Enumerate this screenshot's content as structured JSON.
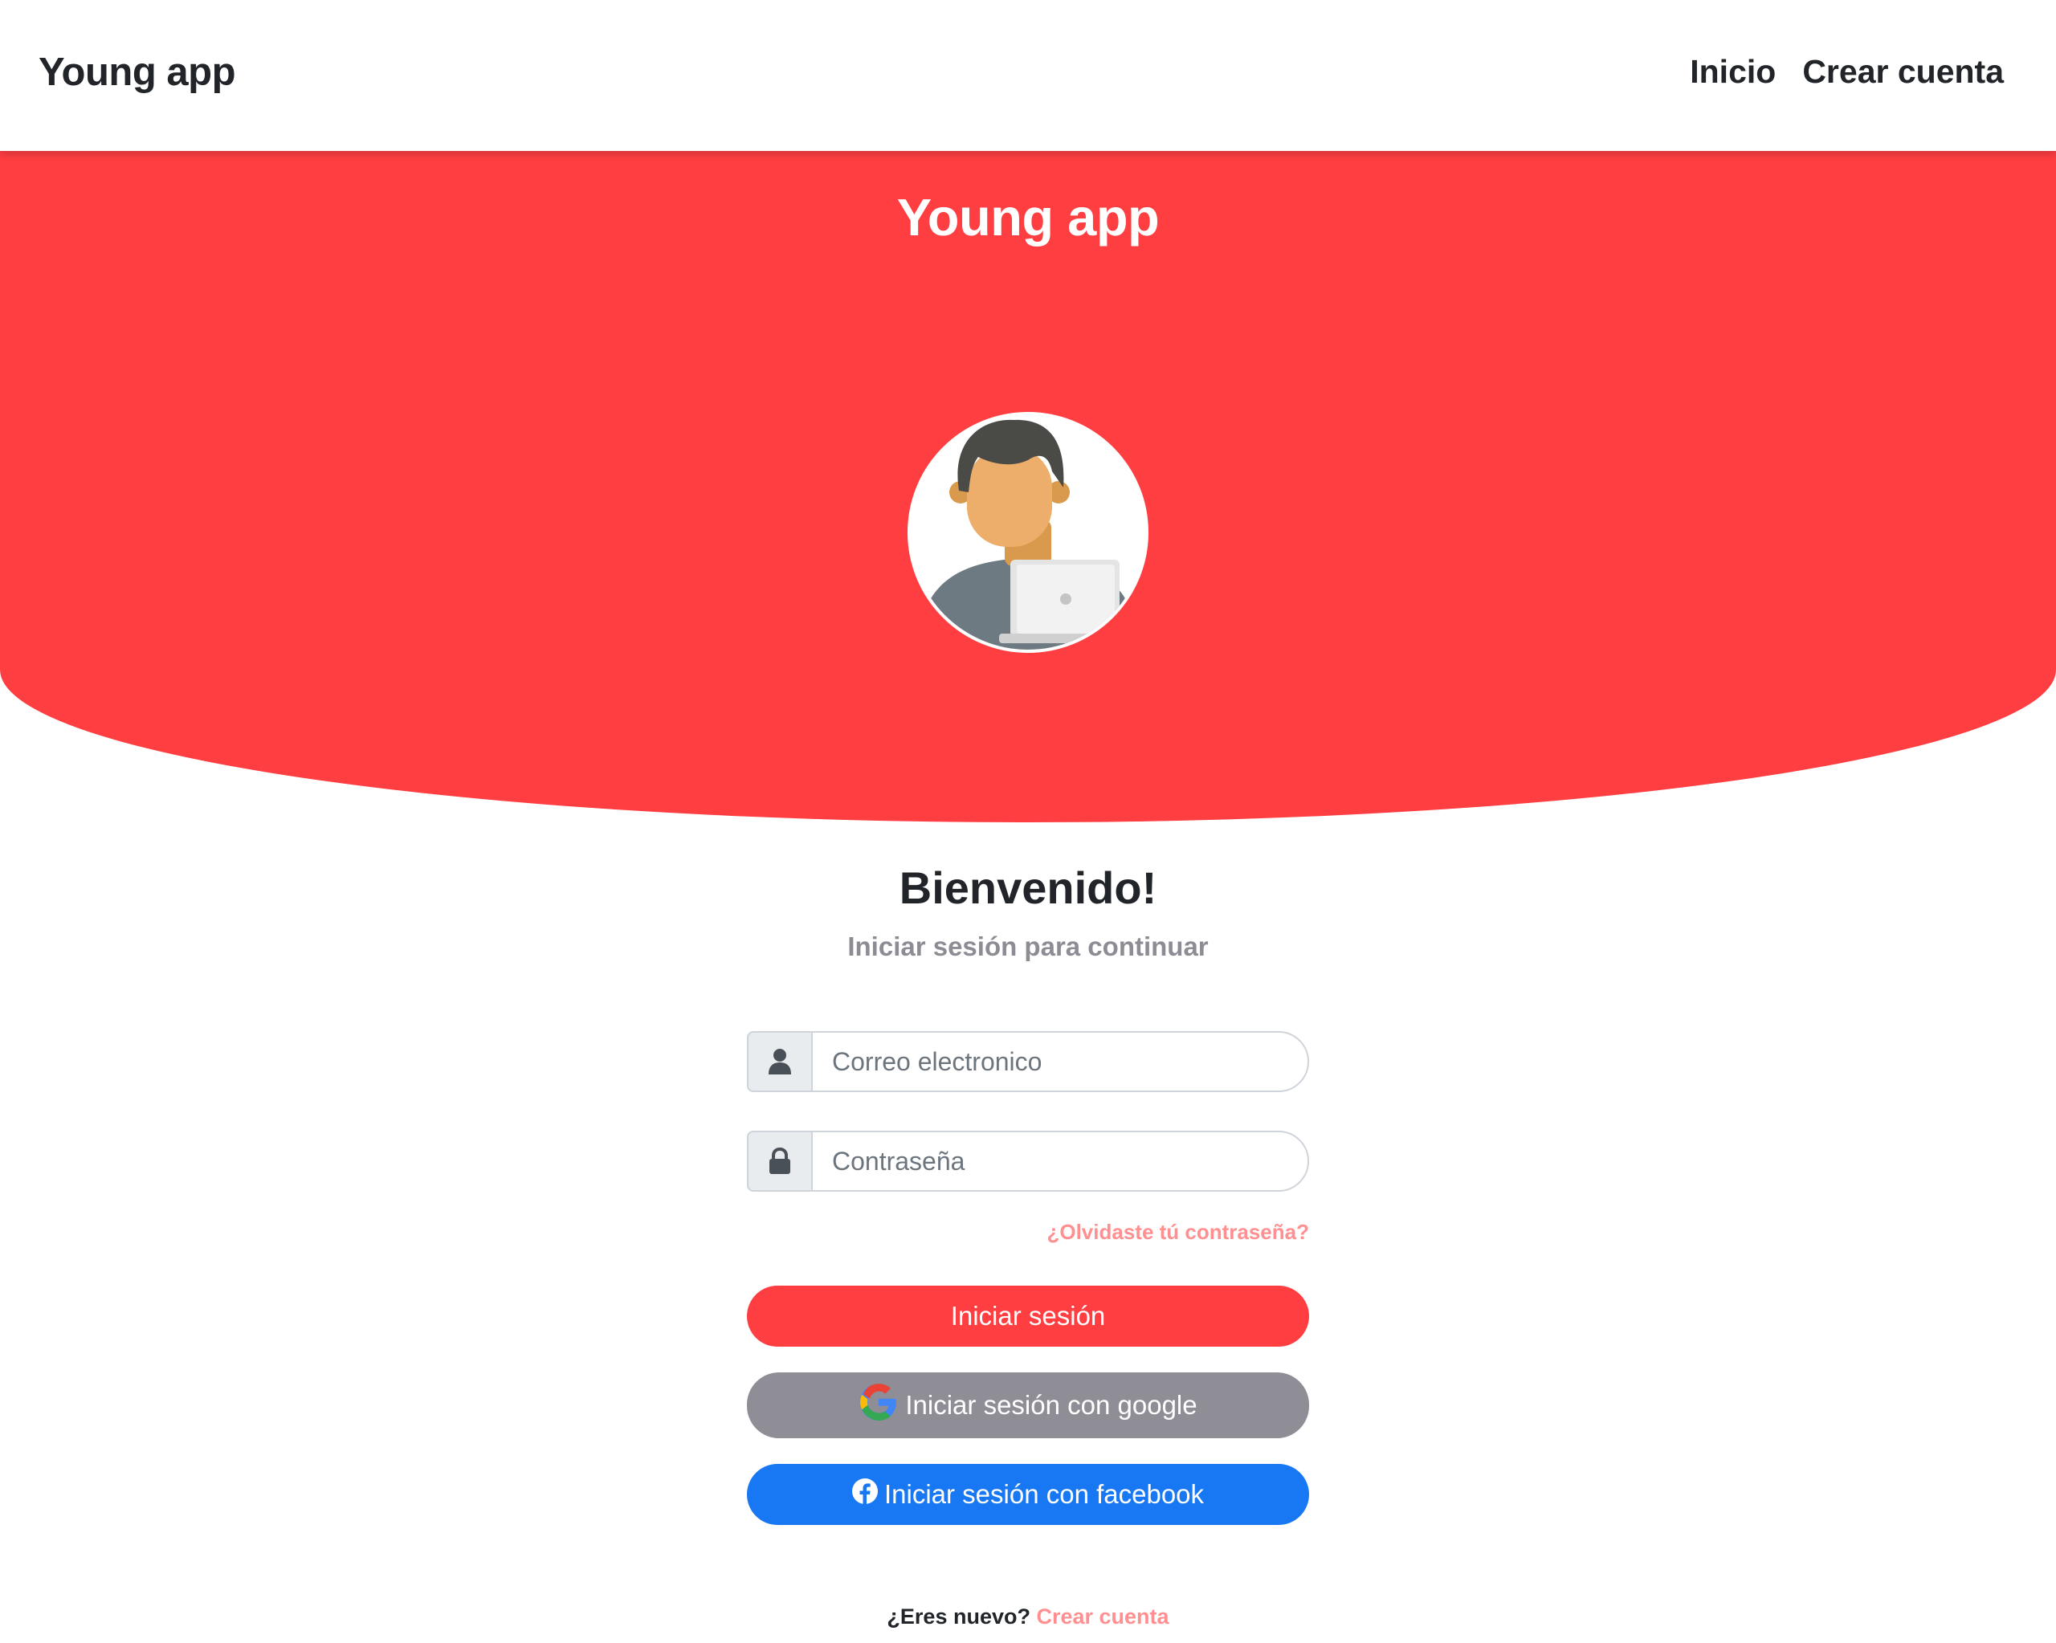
{
  "navbar": {
    "brand": "Young app",
    "links": [
      "Inicio",
      "Crear cuenta"
    ]
  },
  "hero": {
    "title": "Young app",
    "avatar_icon": "user-with-laptop-avatar",
    "background_color": "#ff3e41"
  },
  "login": {
    "heading": "Bienvenido!",
    "subheading": "Iniciar sesión para continuar",
    "email_placeholder": "Correo electronico",
    "email_icon": "user-icon",
    "password_placeholder": "Contraseña",
    "password_icon": "lock-icon",
    "forgot_password": "¿Olvidaste tú contraseña?",
    "login_button": "Iniciar sesión",
    "google_button": "Iniciar sesión con google",
    "facebook_button": "Iniciar sesión con facebook",
    "new_user_prompt": "¿Eres nuevo?",
    "create_account_link": "Crear cuenta"
  },
  "colors": {
    "primary": "#ff3e41",
    "google_button": "#8f8e97",
    "facebook_button": "#1877f2",
    "link": "#ff8f91"
  }
}
